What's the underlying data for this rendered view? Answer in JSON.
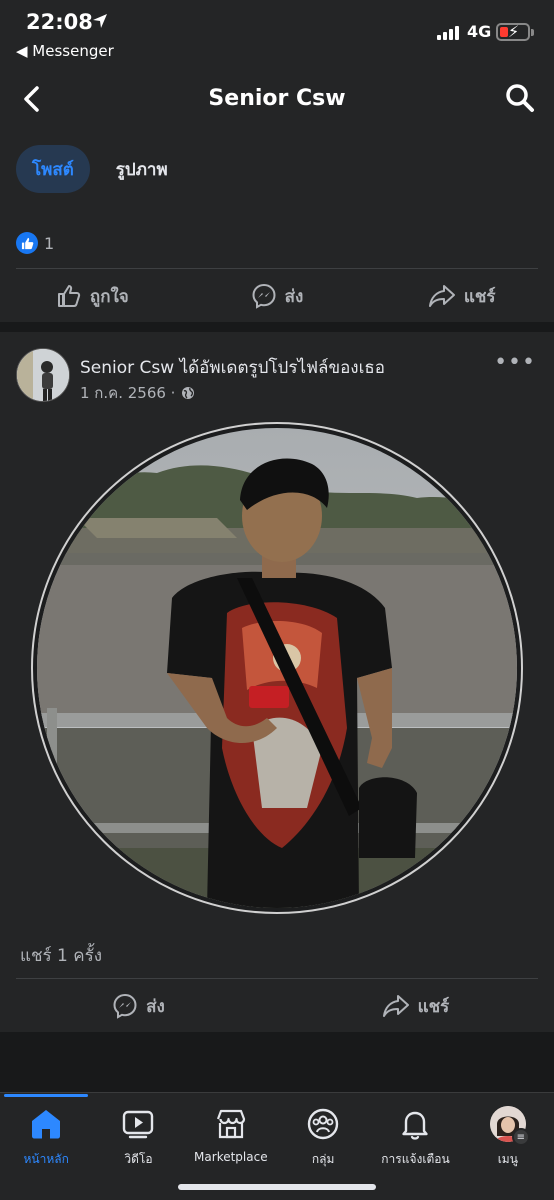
{
  "status_bar": {
    "time": "22:08",
    "back_app": "◀ Messenger",
    "network": "4G"
  },
  "header": {
    "title": "Senior Csw"
  },
  "tabs": [
    {
      "label": "โพสต์",
      "active": true
    },
    {
      "label": "รูปภาพ",
      "active": false
    }
  ],
  "reaction_summary": {
    "count": "1"
  },
  "top_actions": {
    "like": "ถูกใจ",
    "send": "ส่ง",
    "share": "แชร์"
  },
  "post": {
    "author": "Senior Csw",
    "action_text": "ได้อัพเดตรูปโปรไฟล์ของเธอ",
    "date": "1 ก.ค. 2566 ·",
    "privacy_icon": "globe-icon",
    "share_count": "แชร์ 1 ครั้ง",
    "actions": {
      "send": "ส่ง",
      "share": "แชร์"
    }
  },
  "bottom_nav": [
    {
      "label": "หน้าหลัก",
      "icon": "home-icon",
      "active": true
    },
    {
      "label": "วิดีโอ",
      "icon": "video-icon",
      "active": false
    },
    {
      "label": "Marketplace",
      "icon": "marketplace-icon",
      "active": false
    },
    {
      "label": "กลุ่ม",
      "icon": "groups-icon",
      "active": false
    },
    {
      "label": "การแจ้งเตือน",
      "icon": "bell-icon",
      "active": false
    },
    {
      "label": "เมนู",
      "icon": "menu-avatar",
      "active": false
    }
  ],
  "colors": {
    "background": "#242526",
    "accent": "#2d88ff",
    "separator": "#18191a",
    "secondary_text": "#b0b3b8"
  }
}
